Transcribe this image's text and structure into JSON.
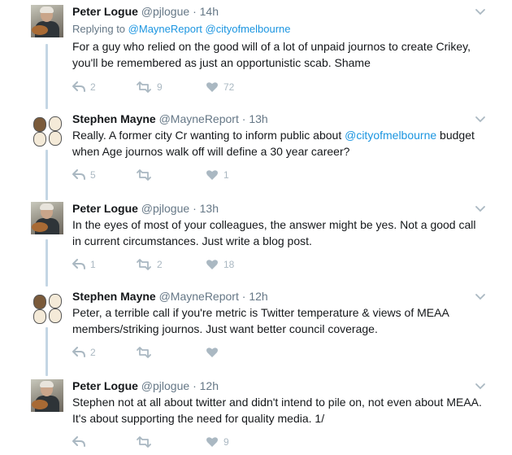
{
  "tweets": [
    {
      "name": "Peter Logue",
      "handle": "@pjlogue",
      "sep": "·",
      "time": "14h",
      "reply_prefix": "Replying to",
      "reply_handles": [
        "@MayneReport",
        "@cityofmelbourne"
      ],
      "text": "For a guy who relied on the good will of a lot of unpaid journos to create Crikey, you'll be remembered as just an opportunistic scab. Shame",
      "replies": "2",
      "retweets": "9",
      "likes": "72",
      "avatar": "peter-logue-guitar-photo"
    },
    {
      "name": "Stephen Mayne",
      "handle": "@MayneReport",
      "sep": "·",
      "time": "13h",
      "text_before": "Really. A former city Cr wanting to inform public about ",
      "text_mention": "@cityofmelbourne",
      "text_after": " budget when Age journos walk off will define a 30 year career?",
      "replies": "5",
      "retweets": "",
      "likes": "1",
      "avatar": "stephen-mayne-cartoon-faces"
    },
    {
      "name": "Peter Logue",
      "handle": "@pjlogue",
      "sep": "·",
      "time": "13h",
      "text": "In the eyes of most of your colleagues, the answer might be yes. Not a good call in current circumstances. Just write a blog post.",
      "replies": "1",
      "retweets": "2",
      "likes": "18",
      "avatar": "peter-logue-guitar-photo"
    },
    {
      "name": "Stephen Mayne",
      "handle": "@MayneReport",
      "sep": "·",
      "time": "12h",
      "text": "Peter, a terrible call if you're metric is Twitter temperature & views of MEAA members/striking journos. Just want better council coverage.",
      "replies": "2",
      "retweets": "",
      "likes": "",
      "avatar": "stephen-mayne-cartoon-faces"
    },
    {
      "name": "Peter Logue",
      "handle": "@pjlogue",
      "sep": "·",
      "time": "12h",
      "text": "Stephen not at all about twitter and didn't intend to pile on, not even about MEAA. It's about supporting the need for quality media. 1/",
      "replies": "",
      "retweets": "",
      "likes": "9",
      "avatar": "peter-logue-guitar-photo"
    }
  ],
  "colors": {
    "name": "#14171a",
    "meta": "#657786",
    "link": "#1b95e0",
    "action_icon": "#aab8c2",
    "thread_line": "#c4d6e4"
  },
  "icons": {
    "reply": "reply-icon",
    "retweet": "retweet-icon",
    "like": "heart-icon",
    "menu": "chevron-down-icon"
  }
}
